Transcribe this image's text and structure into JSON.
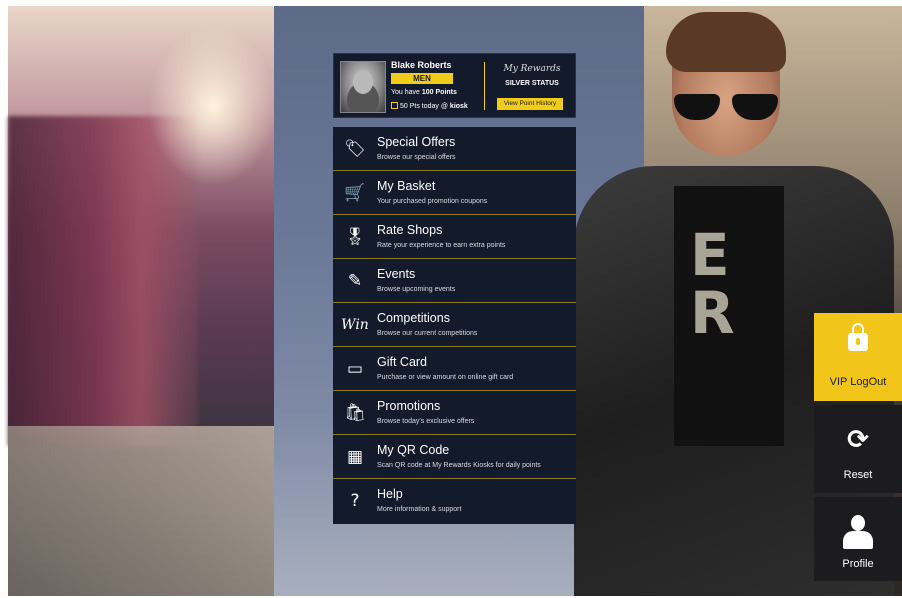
{
  "profile": {
    "name": "Blake Roberts",
    "level": "MEN",
    "points_prefix": "You have ",
    "points_value": "100 Points",
    "today_prefix": "50 Pts today @ ",
    "today_place": "kiosk",
    "brand": "My Rewards",
    "status": "SILVER STATUS",
    "history_button": "View Point History"
  },
  "menu": [
    {
      "icon": "tag-icon",
      "title": "Special Offers",
      "subtitle": "Browse our special offers"
    },
    {
      "icon": "cart-icon",
      "title": "My Basket",
      "subtitle": "Your purchased promotion coupons"
    },
    {
      "icon": "ribbon-icon",
      "title": "Rate Shops",
      "subtitle": "Rate your experience to earn extra points"
    },
    {
      "icon": "pen-icon",
      "title": "Events",
      "subtitle": "Browse upcoming events"
    },
    {
      "icon": "win-icon",
      "title": "Competitions",
      "subtitle": "Browse our current competitions"
    },
    {
      "icon": "gift-card-icon",
      "title": "Gift Card",
      "subtitle": "Purchase or view amount on online gift card"
    },
    {
      "icon": "promo-bag-icon",
      "title": "Promotions",
      "subtitle": "Browse today's exclusive offers"
    },
    {
      "icon": "qr-icon",
      "title": "My QR Code",
      "subtitle": "Scan QR code at My Rewards Kiosks for daily points"
    },
    {
      "icon": "help-icon",
      "title": "Help",
      "subtitle": "More information & support"
    }
  ],
  "menu_glyphs": [
    "🏷",
    "🛒",
    "🎖",
    "✎",
    "Win",
    "▭",
    "🛍",
    "▦",
    "?"
  ],
  "side": {
    "vip_logout": "VIP LogOut",
    "reset": "Reset",
    "profile": "Profile"
  },
  "colors": {
    "accent": "#f2c51b",
    "panel": "#131a2c",
    "center_bg": "#6b7898"
  }
}
